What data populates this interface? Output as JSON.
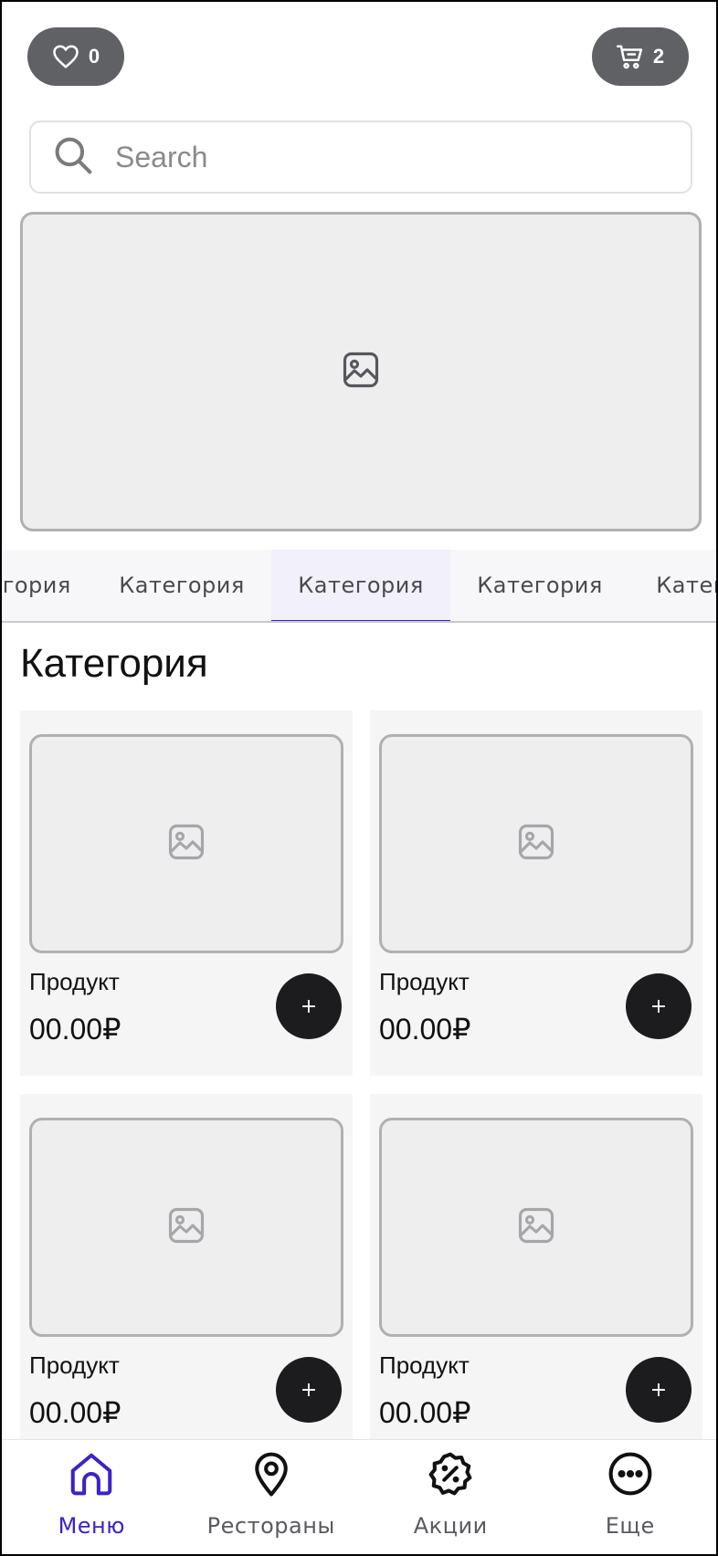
{
  "header": {
    "favorites_count": "0",
    "cart_count": "2"
  },
  "search": {
    "placeholder": "Search",
    "value": ""
  },
  "banner": {
    "icon": "image-placeholder-icon"
  },
  "tabs": [
    {
      "label": "Категория",
      "active": false
    },
    {
      "label": "Категория",
      "active": false
    },
    {
      "label": "Категория",
      "active": true
    },
    {
      "label": "Категория",
      "active": false
    },
    {
      "label": "Категория",
      "active": false
    }
  ],
  "section": {
    "title": "Категория"
  },
  "products": [
    {
      "name": "Продукт",
      "price": "00.00₽",
      "add_label": "+"
    },
    {
      "name": "Продукт",
      "price": "00.00₽",
      "add_label": "+"
    },
    {
      "name": "Продукт",
      "price": "00.00₽",
      "add_label": "+"
    },
    {
      "name": "Продукт",
      "price": "00.00₽",
      "add_label": "+"
    }
  ],
  "bottom_nav": [
    {
      "label": "Меню",
      "icon": "home-icon",
      "active": true
    },
    {
      "label": "Рестораны",
      "icon": "map-pin-icon",
      "active": false
    },
    {
      "label": "Акции",
      "icon": "discount-badge-icon",
      "active": false
    },
    {
      "label": "Еще",
      "icon": "more-icon",
      "active": false
    }
  ],
  "colors": {
    "accent": "#3d22c7",
    "pill_bg": "#5f6165",
    "add_button_bg": "#1c1c1e",
    "placeholder_border": "#b0b0b4"
  }
}
